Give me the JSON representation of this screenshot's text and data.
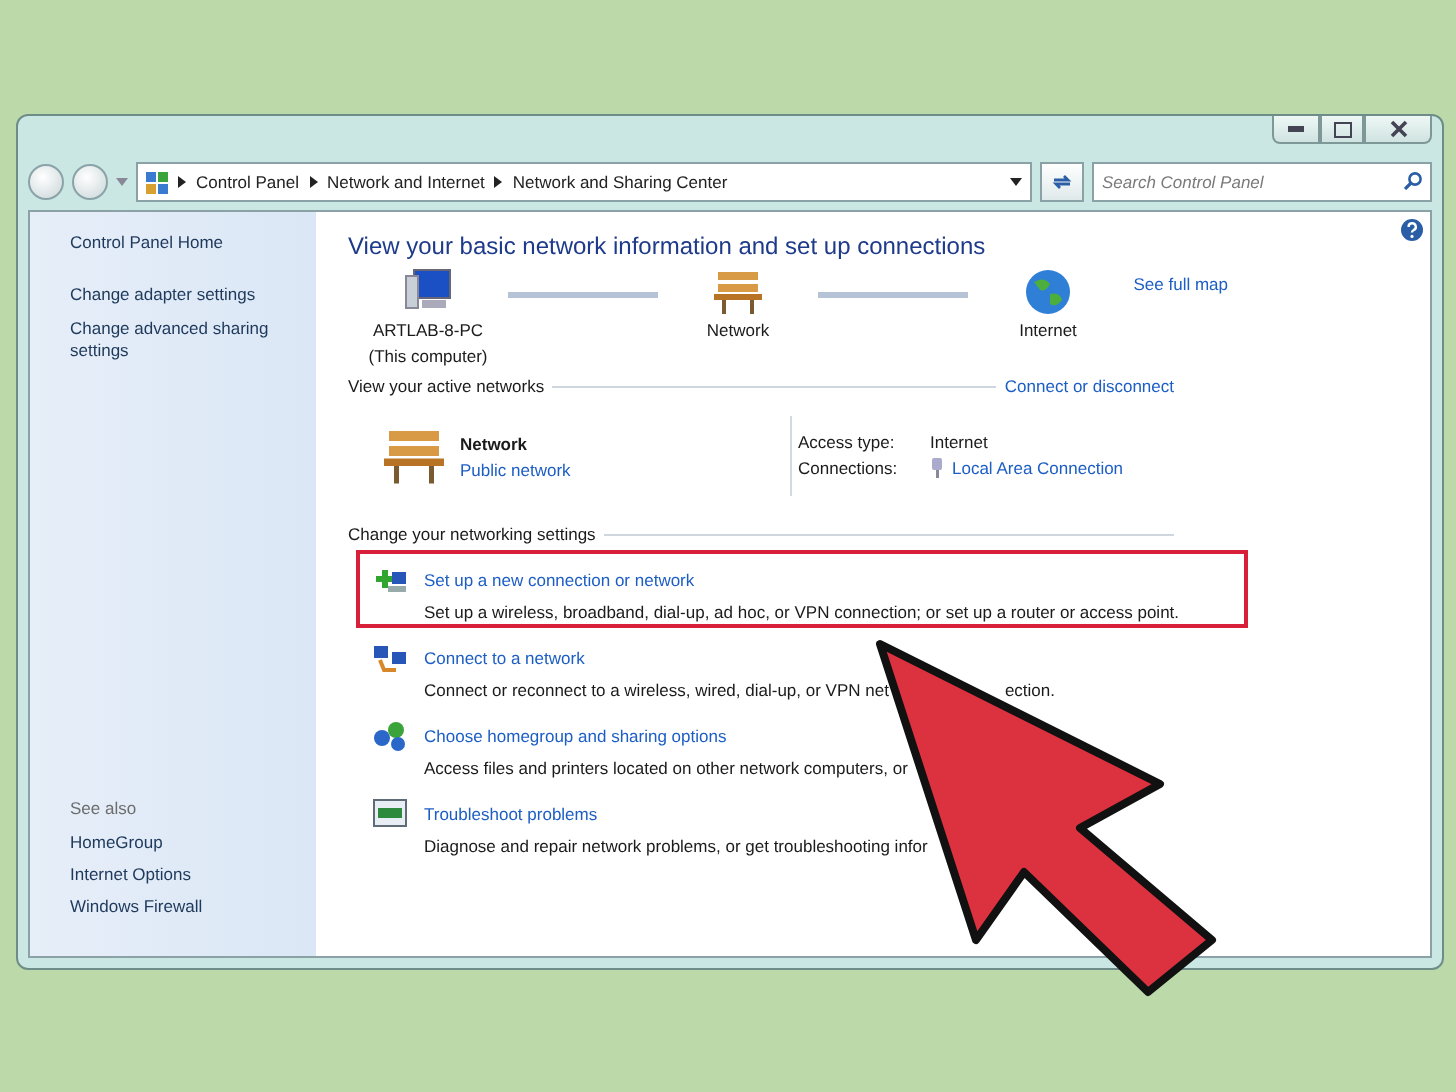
{
  "address_bar": {
    "crumbs": [
      "Control Panel",
      "Network and Internet",
      "Network and Sharing Center"
    ]
  },
  "search": {
    "placeholder": "Search Control Panel"
  },
  "sidebar": {
    "items": [
      {
        "label": "Control Panel Home"
      },
      {
        "label": "Change adapter settings"
      },
      {
        "label": "Change advanced sharing settings"
      }
    ],
    "see_also_title": "See also",
    "see_also": [
      "HomeGroup",
      "Internet Options",
      "Windows Firewall"
    ]
  },
  "main": {
    "title": "View your basic network information and set up connections",
    "map": {
      "nodes": [
        {
          "kind": "computer",
          "label": "ARTLAB-8-PC",
          "sublabel": "(This computer)"
        },
        {
          "kind": "bench",
          "label": "Network"
        },
        {
          "kind": "globe",
          "label": "Internet"
        }
      ],
      "link": "See full map"
    },
    "active": {
      "heading": "View your active networks",
      "link": "Connect or disconnect",
      "network": {
        "name": "Network",
        "type": "Public network"
      },
      "rows": [
        {
          "label": "Access type:",
          "value": "Internet",
          "kind": "text"
        },
        {
          "label": "Connections:",
          "value": "Local Area Connection",
          "kind": "link"
        }
      ]
    },
    "settings": {
      "heading": "Change your networking settings",
      "tasks": [
        {
          "kind": "new-connection",
          "title": "Set up a new connection or network",
          "description": "Set up a wireless, broadband, dial-up, ad hoc, or VPN connection; or set up a router or access point.",
          "highlighted": true
        },
        {
          "kind": "connect",
          "title": "Connect to a network",
          "description": "Connect or reconnect to a wireless, wired, dial-up, or VPN net",
          "description_tail": "ection.",
          "highlighted": false
        },
        {
          "kind": "homegroup",
          "title": "Choose homegroup and sharing options",
          "description": "Access files and printers located on other network computers, or",
          "highlighted": false
        },
        {
          "kind": "troubleshoot",
          "title": "Troubleshoot problems",
          "description": "Diagnose and repair network problems, or get troubleshooting infor",
          "highlighted": false
        }
      ]
    }
  }
}
